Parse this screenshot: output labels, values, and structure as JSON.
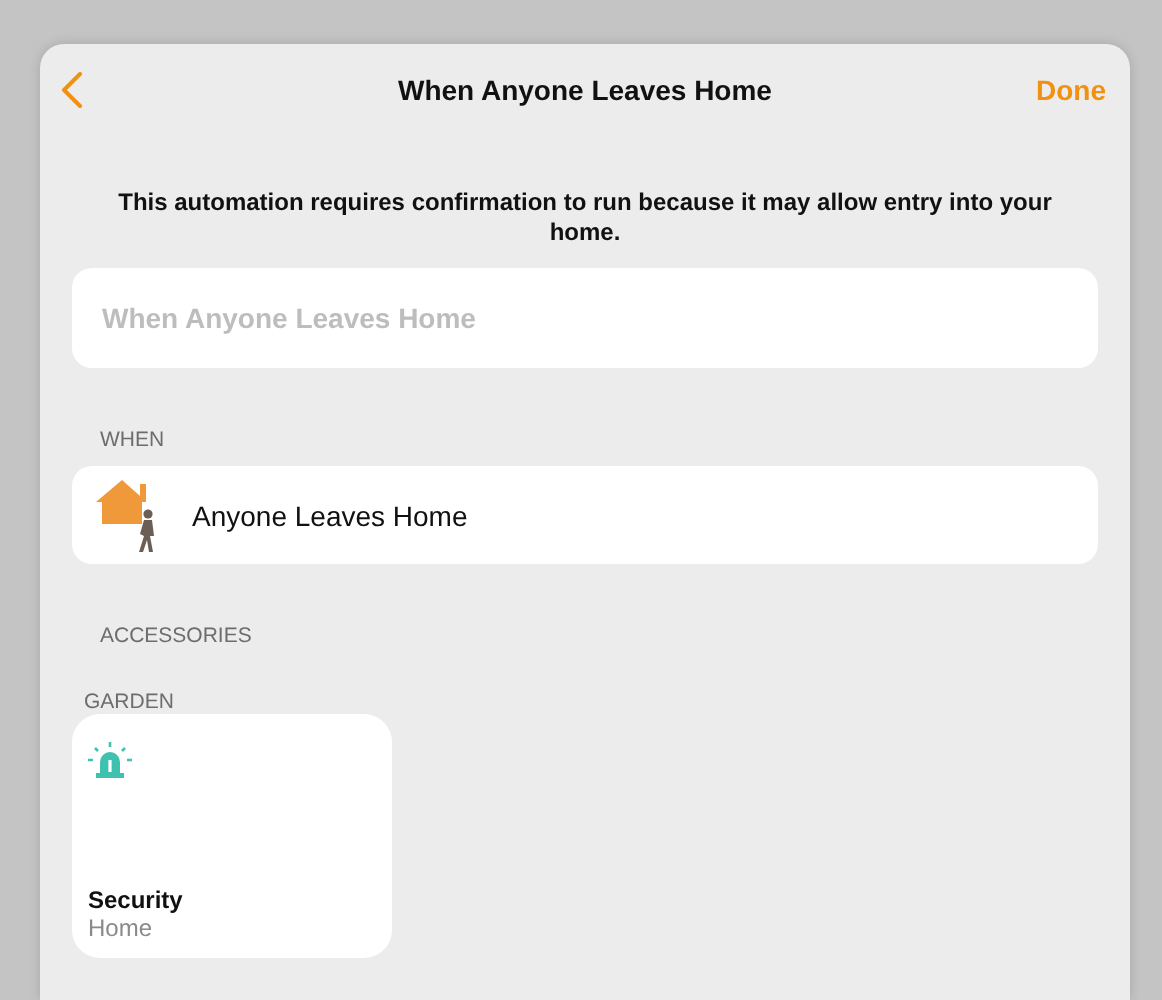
{
  "nav": {
    "title": "When Anyone Leaves Home",
    "done": "Done"
  },
  "notice": "This automation requires confirmation to run because it may allow entry into your home.",
  "name_field": {
    "placeholder": "When Anyone Leaves Home"
  },
  "when": {
    "header": "WHEN",
    "trigger": "Anyone Leaves Home"
  },
  "accessories": {
    "header": "ACCESSORIES",
    "rooms": [
      {
        "name": "GARDEN",
        "tiles": [
          {
            "name": "Security",
            "room": "Home"
          }
        ]
      }
    ]
  }
}
